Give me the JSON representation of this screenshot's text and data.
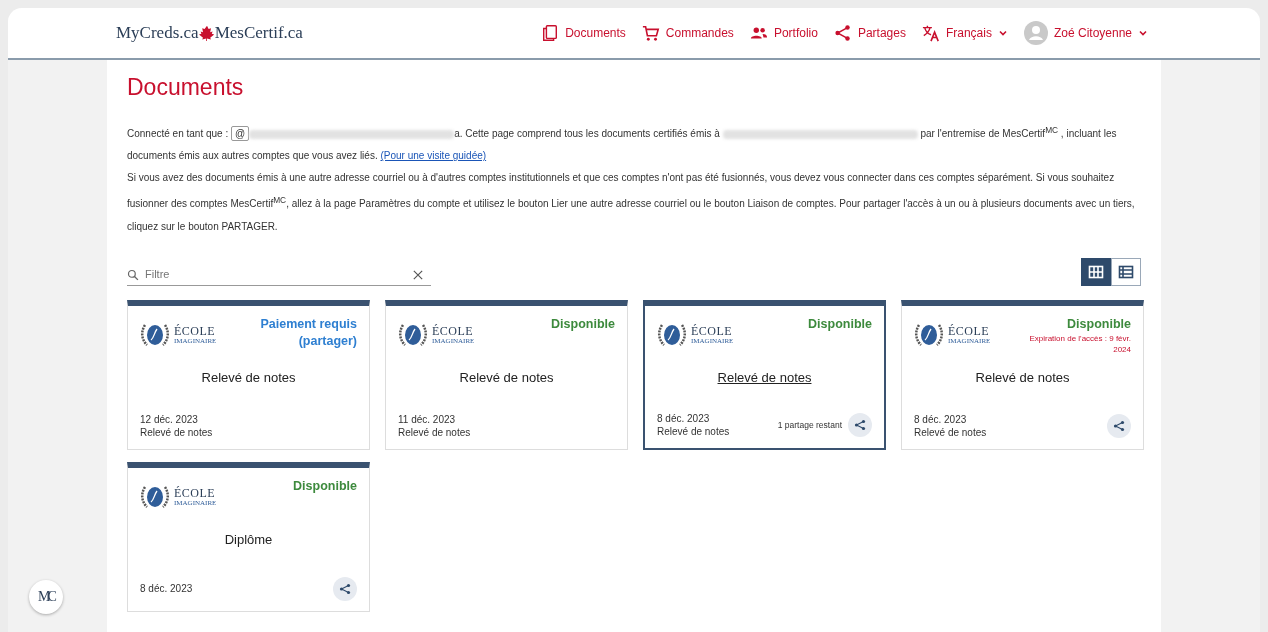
{
  "brand": {
    "left": "MyCreds.ca",
    "right": "MesCertif.ca"
  },
  "nav": [
    {
      "kind": "documents",
      "label": "Documents"
    },
    {
      "kind": "orders",
      "label": "Commandes"
    },
    {
      "kind": "portfolio",
      "label": "Portfolio"
    },
    {
      "kind": "shares",
      "label": "Partages"
    },
    {
      "kind": "language",
      "label": "Français"
    },
    {
      "kind": "user",
      "label": "Zoé Citoyenne"
    }
  ],
  "side_logo": "MC",
  "page_title": "Documents",
  "intro": {
    "before": "Connecté en tant que :",
    "field_value": "@",
    "part2": "a. Cette page comprend tous les documents certifiés émis à",
    "part3": "par l'entremise de MesCertif$^{MC}$ , incluant les documents émis aux autres comptes que vous avez liés.",
    "link": "(Pour une visite guidée)"
  },
  "paragraph": "Si vous avez des documents émis à une autre adresse courriel ou à d'autres comptes institutionnels et que ces comptes n'ont pas été fusionnés, vous devez vous connecter dans ces comptes séparément. Si vous souhaitez fusionner des comptes MesCertif$^{MC}$, allez à la page Paramètres du compte et utilisez le bouton Lier une autre adresse courriel ou le bouton Liaison de comptes. Pour partager l'accès à un ou à plusieurs documents avec un tiers, cliquez sur le bouton PARTAGER.",
  "filter": {
    "placeholder": "Filtre"
  },
  "views": [
    {
      "kind": "grid",
      "selected": true
    },
    {
      "kind": "list",
      "selected": false
    }
  ],
  "cards": [
    {
      "logo": [
        "ÉCOLE",
        "IMAGINAIRE"
      ],
      "color": "#2e7fd1",
      "status": "Paiement requis (partager)",
      "title": "Relevé de notes",
      "date": "12 déc. 2023",
      "type": "Relevé de notes",
      "selected": false,
      "share": false
    },
    {
      "logo": [
        "ÉCOLE",
        "IMAGINAIRE"
      ],
      "color": "#3d8a3d",
      "status": "Disponible",
      "title": "Relevé de notes",
      "date": "11 déc. 2023",
      "type": "Relevé de notes",
      "selected": false,
      "share": false
    },
    {
      "logo": [
        "ÉCOLE",
        "IMAGINAIRE"
      ],
      "color": "#3d8a3d",
      "status": "Disponible",
      "title": "Relevé de notes",
      "date": "8 déc. 2023",
      "type": "Relevé de notes",
      "selected": true,
      "share": true,
      "shares_left": "1 partage restant"
    },
    {
      "logo": [
        "ÉCOLE",
        "IMAGINAIRE"
      ],
      "color": "#3d8a3d",
      "status": "Disponible",
      "expiry": "Expiration de l'accès : 9 févr. 2024",
      "title": "Relevé de notes",
      "date": "8 déc. 2023",
      "type": "Relevé de notes",
      "selected": false,
      "share": true
    },
    {
      "logo": [
        "ÉCOLE",
        "IMAGINAIRE"
      ],
      "color": "#3d8a3d",
      "status": "Disponible",
      "title": "Diplôme",
      "date": "8 déc. 2023",
      "selected": false,
      "share": true
    }
  ]
}
